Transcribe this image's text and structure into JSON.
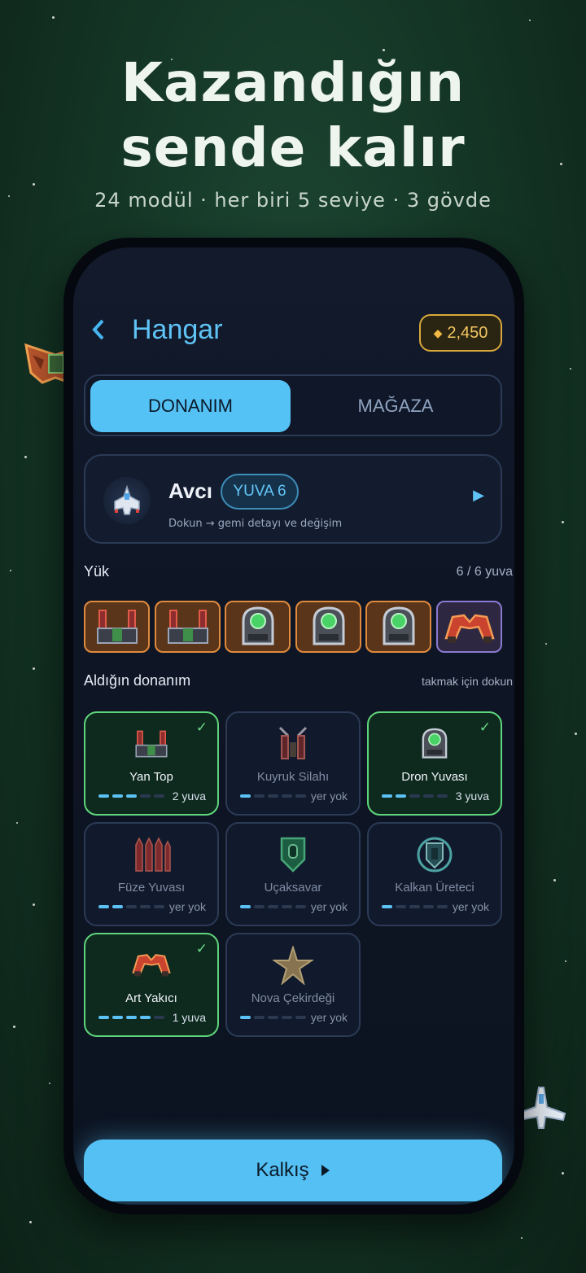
{
  "hero": {
    "title_line1": "Kazandığın",
    "title_line2": "sende kalır",
    "subtitle": "24 modül · her biri 5 seviye · 3 gövde"
  },
  "header": {
    "back_icon": "chevron-left-icon",
    "title": "Hangar",
    "coins": "2,450",
    "coin_icon": "diamond-icon"
  },
  "tabs": {
    "active": "DONANIM",
    "inactive": "MAĞAZA"
  },
  "ship": {
    "name": "Avcı",
    "slot_badge": "YUVA 6",
    "hint": "Dokun → gemi detayı ve değişim"
  },
  "loadout": {
    "label": "Yük",
    "count": "6 / 6 yuva",
    "slots": [
      {
        "icon": "side-cannon-icon"
      },
      {
        "icon": "side-cannon-icon"
      },
      {
        "icon": "drone-bay-icon"
      },
      {
        "icon": "drone-bay-icon"
      },
      {
        "icon": "drone-bay-icon"
      },
      {
        "icon": "afterburner-icon"
      }
    ]
  },
  "owned": {
    "label": "Aldığın donanım",
    "hint": "takmak için dokun",
    "items": [
      {
        "name": "Yan Top",
        "status": "2 yuva",
        "owned": true,
        "level": 3,
        "icon": "side-cannon-icon"
      },
      {
        "name": "Kuyruk Silahı",
        "status": "yer yok",
        "owned": false,
        "level": 1,
        "icon": "tail-gun-icon"
      },
      {
        "name": "Dron Yuvası",
        "status": "3 yuva",
        "owned": true,
        "level": 2,
        "icon": "drone-bay-icon"
      },
      {
        "name": "Füze Yuvası",
        "status": "yer yok",
        "owned": false,
        "level": 2,
        "icon": "missile-pod-icon"
      },
      {
        "name": "Uçaksavar",
        "status": "yer yok",
        "owned": false,
        "level": 1,
        "icon": "flak-icon"
      },
      {
        "name": "Kalkan Üreteci",
        "status": "yer yok",
        "owned": false,
        "level": 1,
        "icon": "shield-generator-icon"
      },
      {
        "name": "Art Yakıcı",
        "status": "1 yuva",
        "owned": true,
        "level": 4,
        "icon": "afterburner-icon"
      },
      {
        "name": "Nova Çekirdeği",
        "status": "yer yok",
        "owned": false,
        "level": 1,
        "icon": "nova-core-icon"
      }
    ]
  },
  "launch": {
    "label": "Kalkış",
    "icon": "play-triangle-icon"
  }
}
